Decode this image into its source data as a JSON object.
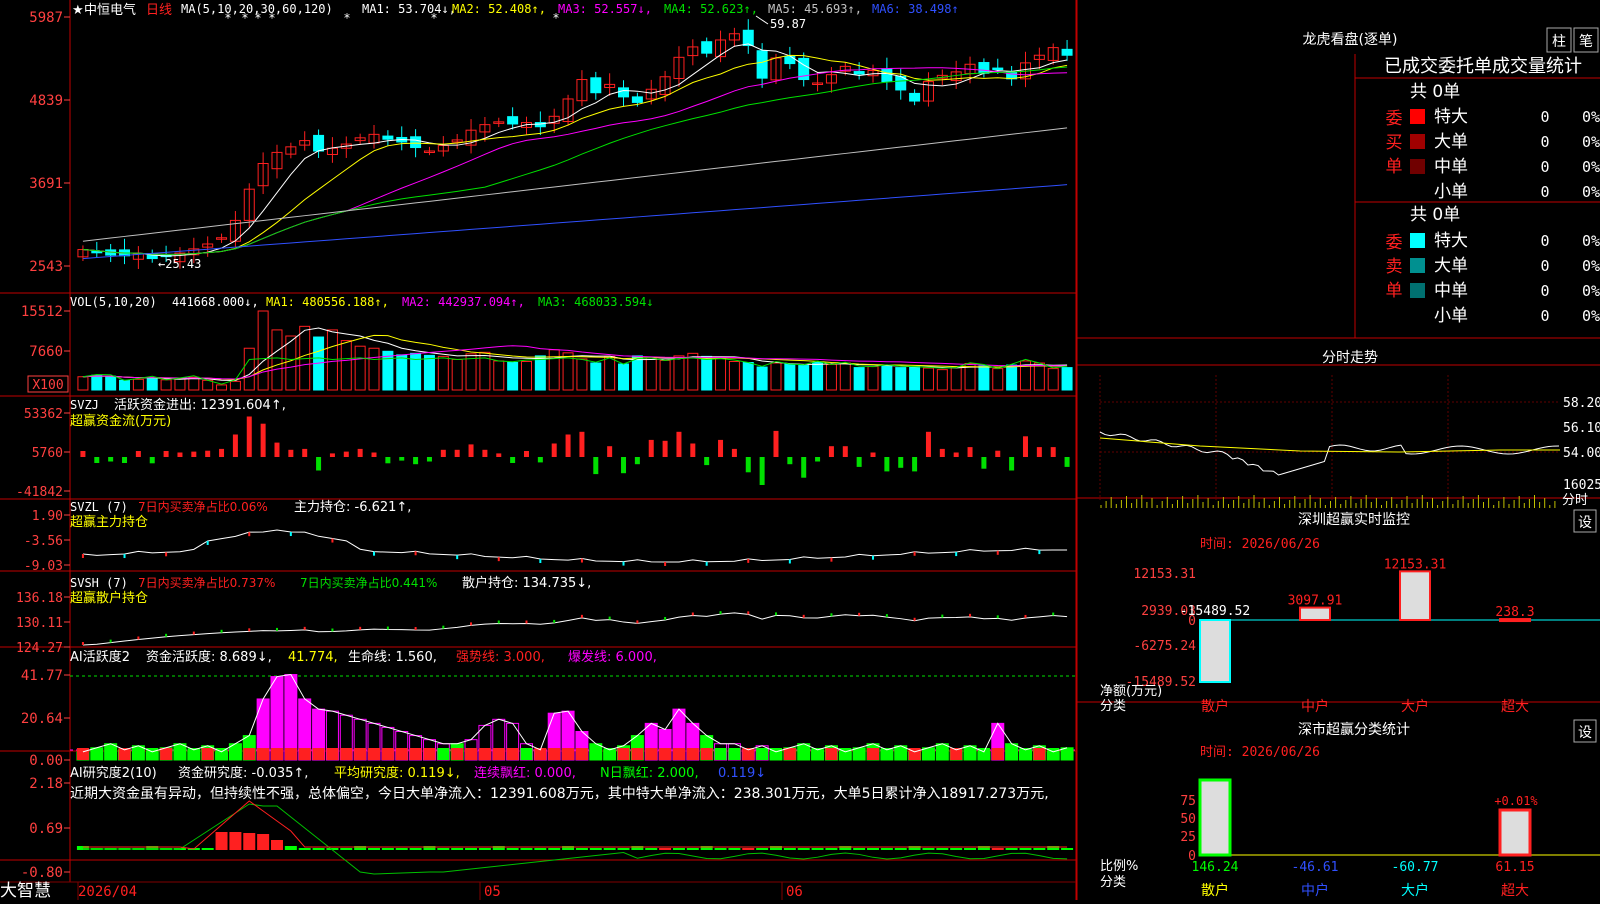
{
  "header": {
    "star": "★",
    "stock_name": "中恒电气",
    "period": "日线",
    "ma_params": "MA(5,10,20,30,60,120)",
    "ma": [
      {
        "label": "MA1: 53.704↓,",
        "color": "#ffffff"
      },
      {
        "label": "MA2: 52.408↑,",
        "color": "#ffff00"
      },
      {
        "label": "MA3: 52.557↓,",
        "color": "#ff00ff"
      },
      {
        "label": "MA4: 52.623↑,",
        "color": "#00e000"
      },
      {
        "label": "MA5: 45.693↑,",
        "color": "#c0c0c0"
      },
      {
        "label": "MA6: 38.498↑",
        "color": "#3050ff"
      }
    ],
    "hi_mark": "59.87",
    "lo_mark": "←25.43"
  },
  "price_axis": [
    "5987",
    "4839",
    "3691",
    "2543"
  ],
  "vol_header": {
    "params": "VOL(5,10,20)",
    "value": "441668.000↓,",
    "ma1": "MA1: 480556.188↑,",
    "ma2": "MA2: 442937.094↑,",
    "ma3": "MA3: 468033.594↓"
  },
  "vol_axis": [
    "15512",
    "7660",
    "X100"
  ],
  "svzj": {
    "title": "SVZJ",
    "label": "活跃资金进出: 12391.604↑,",
    "sub": "超赢资金流(万元)",
    "axis": [
      "53362",
      "5760",
      "-41842"
    ]
  },
  "svzl": {
    "title": "SVZL (7)",
    "l1": "7日内买卖净占比0.06%",
    "l2": "主力持仓: -6.621↑,",
    "sub": "超赢主力持仓",
    "axis": [
      "1.90",
      "-3.56",
      "-9.03"
    ]
  },
  "svsh": {
    "title": "SVSH (7)",
    "l1": "7日内买卖净占比0.737%",
    "l2": "7日内买卖净占比0.441%",
    "l3": "散户持仓: 134.735↓,",
    "sub": "超赢散户持仓",
    "axis": [
      "136.18",
      "130.11",
      "124.27"
    ]
  },
  "ai1": {
    "title": "AI活跃度2",
    "l1": "资金活跃度: 8.689↓,",
    "l2": "41.774,",
    "l3": "生命线: 1.560,",
    "l4": "强势线: 3.000,",
    "l5": "爆发线: 6.000,",
    "axis": [
      "41.77",
      "20.64",
      "0.00"
    ]
  },
  "ai2": {
    "title": "AI研究度2(10)",
    "l1": "资金研究度: -0.035↑,",
    "l2": "平均研究度: 0.119↓,",
    "l3": "连续飘红: 0.000,",
    "l4": "N日飘红: 2.000,",
    "l5": "0.119↓",
    "comment": "近期大资金虽有异动，但持续性不强，总体偏空，今日大单净流入：12391.608万元，其中特大单净流入：238.301万元，大单5日累计净入18917.273万元,",
    "axis": [
      "2.18",
      "0.69",
      "-0.80"
    ]
  },
  "bottom": {
    "brand": "大智慧",
    "date1": "2026/04",
    "date2": "05",
    "date3": "06"
  },
  "lhb": {
    "title": "龙虎看盘(逐单)",
    "btn1": "柱",
    "btn2": "笔",
    "subtitle": "已成交委托单成交量统计",
    "buy_label": "委买单",
    "sell_label": "委卖单",
    "buy_total": "共 0单",
    "sell_total": "共 0单",
    "buy_rows": [
      {
        "name": "特大",
        "value": "0",
        "pct": "0%",
        "color": "#ff0000"
      },
      {
        "name": "大单",
        "value": "0",
        "pct": "0%",
        "color": "#a00000"
      },
      {
        "name": "中单",
        "value": "0",
        "pct": "0%",
        "color": "#700000"
      },
      {
        "name": "小单",
        "value": "0",
        "pct": "0%",
        "color": "#000000"
      }
    ],
    "sell_rows": [
      {
        "name": "特大",
        "value": "0",
        "pct": "0%",
        "color": "#00ffff"
      },
      {
        "name": "大单",
        "value": "0",
        "pct": "0%",
        "color": "#009090"
      },
      {
        "name": "中单",
        "value": "0",
        "pct": "0%",
        "color": "#007070"
      },
      {
        "name": "小单",
        "value": "0",
        "pct": "0%",
        "color": "#000000"
      }
    ]
  },
  "fenshi": {
    "title": "分时走势",
    "axis": [
      "58.20",
      "56.10",
      "54.00",
      "16025"
    ],
    "suffix": "分时"
  },
  "sz_monitor": {
    "title": "深圳超赢实时监控",
    "setting": "设",
    "time_label": "时间: 2026/06/26",
    "axis": [
      "12153.31",
      "2939.03",
      "0",
      "-6275.24",
      "-15489.52"
    ],
    "unit": "净额(万元)",
    "cat_label": "分类",
    "categories": [
      "散户",
      "中户",
      "大户",
      "超大"
    ],
    "values": [
      -15489.52,
      3097.91,
      12153.31,
      238.3
    ],
    "value_labels": [
      "-15489.52",
      "3097.91",
      "12153.31",
      "238.3"
    ]
  },
  "sz_class": {
    "title": "深市超赢分类统计",
    "setting": "设",
    "time_label": "时间: 2026/06/26",
    "axis": [
      "75",
      "50",
      "25",
      "0"
    ],
    "unit": "比例%",
    "cat_label": "分类",
    "categories": [
      "散户",
      "中户",
      "大户",
      "超大"
    ],
    "values": [
      146.24,
      -46.61,
      -60.77,
      61.15
    ],
    "value_labels": [
      "146.24",
      "-46.61",
      "-60.77",
      "61.15"
    ],
    "extra_label": "+0.01%"
  },
  "colors": {
    "up": "#ff2020",
    "down": "#00ffff",
    "border": "#c00000",
    "axis_text": "#ff4040"
  },
  "chart_data": {
    "type": "candlestick",
    "title": "中恒电气 日线",
    "ylim": [
      25.43,
      59.87
    ],
    "note": "daily candles approximated; values in price units",
    "closes": [
      27.8,
      27.5,
      27.0,
      26.9,
      27.2,
      26.5,
      26.8,
      27.3,
      27.9,
      28.6,
      29.5,
      32.0,
      36.5,
      40.2,
      41.8,
      42.6,
      43.5,
      42.0,
      42.4,
      43.0,
      43.9,
      44.4,
      43.7,
      43.3,
      42.5,
      42.0,
      42.8,
      43.6,
      45.0,
      45.8,
      46.2,
      45.9,
      46.1,
      45.5,
      47.0,
      49.5,
      52.3,
      50.4,
      51.6,
      49.8,
      49.0,
      50.9,
      52.7,
      55.5,
      57.0,
      56.1,
      58.0,
      58.9,
      57.2,
      52.5,
      55.4,
      54.6,
      52.3,
      51.8,
      53.0,
      54.2,
      53.1,
      53.6,
      52.0,
      50.8,
      49.2,
      52.0,
      52.9,
      53.4,
      54.5,
      53.2,
      53.9,
      52.4,
      54.7,
      55.8,
      56.9,
      55.8
    ],
    "volumes_x100": [
      2600,
      2900,
      2700,
      1900,
      2100,
      2400,
      2000,
      2200,
      2500,
      1900,
      1000,
      1700,
      8200,
      15512,
      11800,
      10600,
      12500,
      10400,
      11800,
      9700,
      8600,
      8200,
      7600,
      6900,
      7200,
      6800,
      6600,
      6000,
      7100,
      7400,
      5700,
      5400,
      5600,
      6700,
      7900,
      7300,
      6100,
      5300,
      6600,
      5100,
      6700,
      6300,
      5800,
      6700,
      7200,
      6600,
      6400,
      5600,
      5400,
      4500,
      5300,
      5100,
      4800,
      5400,
      5000,
      5300,
      4400,
      4600,
      4800,
      4400,
      4600,
      4300,
      4000,
      4400,
      5200,
      4700,
      4200,
      4900,
      5700,
      5300,
      4200,
      4400
    ]
  }
}
